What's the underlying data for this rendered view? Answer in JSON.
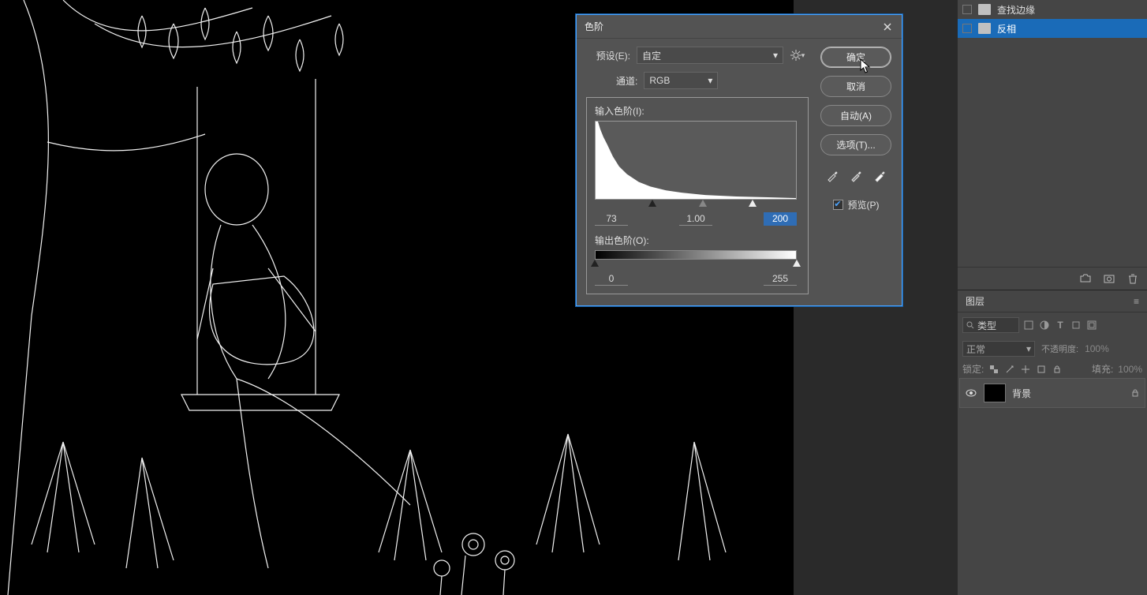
{
  "dialog": {
    "title": "色阶",
    "preset_label": "预设(E):",
    "preset_value": "自定",
    "channel_label": "通道:",
    "channel_value": "RGB",
    "input_levels_label": "输入色阶(I):",
    "output_levels_label": "输出色阶(O):",
    "input_black": "73",
    "input_gamma": "1.00",
    "input_white": "200",
    "output_black": "0",
    "output_white": "255",
    "ok": "确定",
    "cancel": "取消",
    "auto": "自动(A)",
    "options": "选项(T)...",
    "preview": "预览(P)"
  },
  "history": {
    "items": [
      {
        "label": "查找边缘",
        "selected": false
      },
      {
        "label": "反相",
        "selected": true
      }
    ]
  },
  "layers": {
    "tab": "图层",
    "filter_placeholder": "类型",
    "blend_mode": "正常",
    "opacity_label": "不透明度:",
    "opacity_value": "100%",
    "lock_label": "锁定:",
    "fill_label": "填充:",
    "fill_value": "100%",
    "layer_name": "背景"
  }
}
